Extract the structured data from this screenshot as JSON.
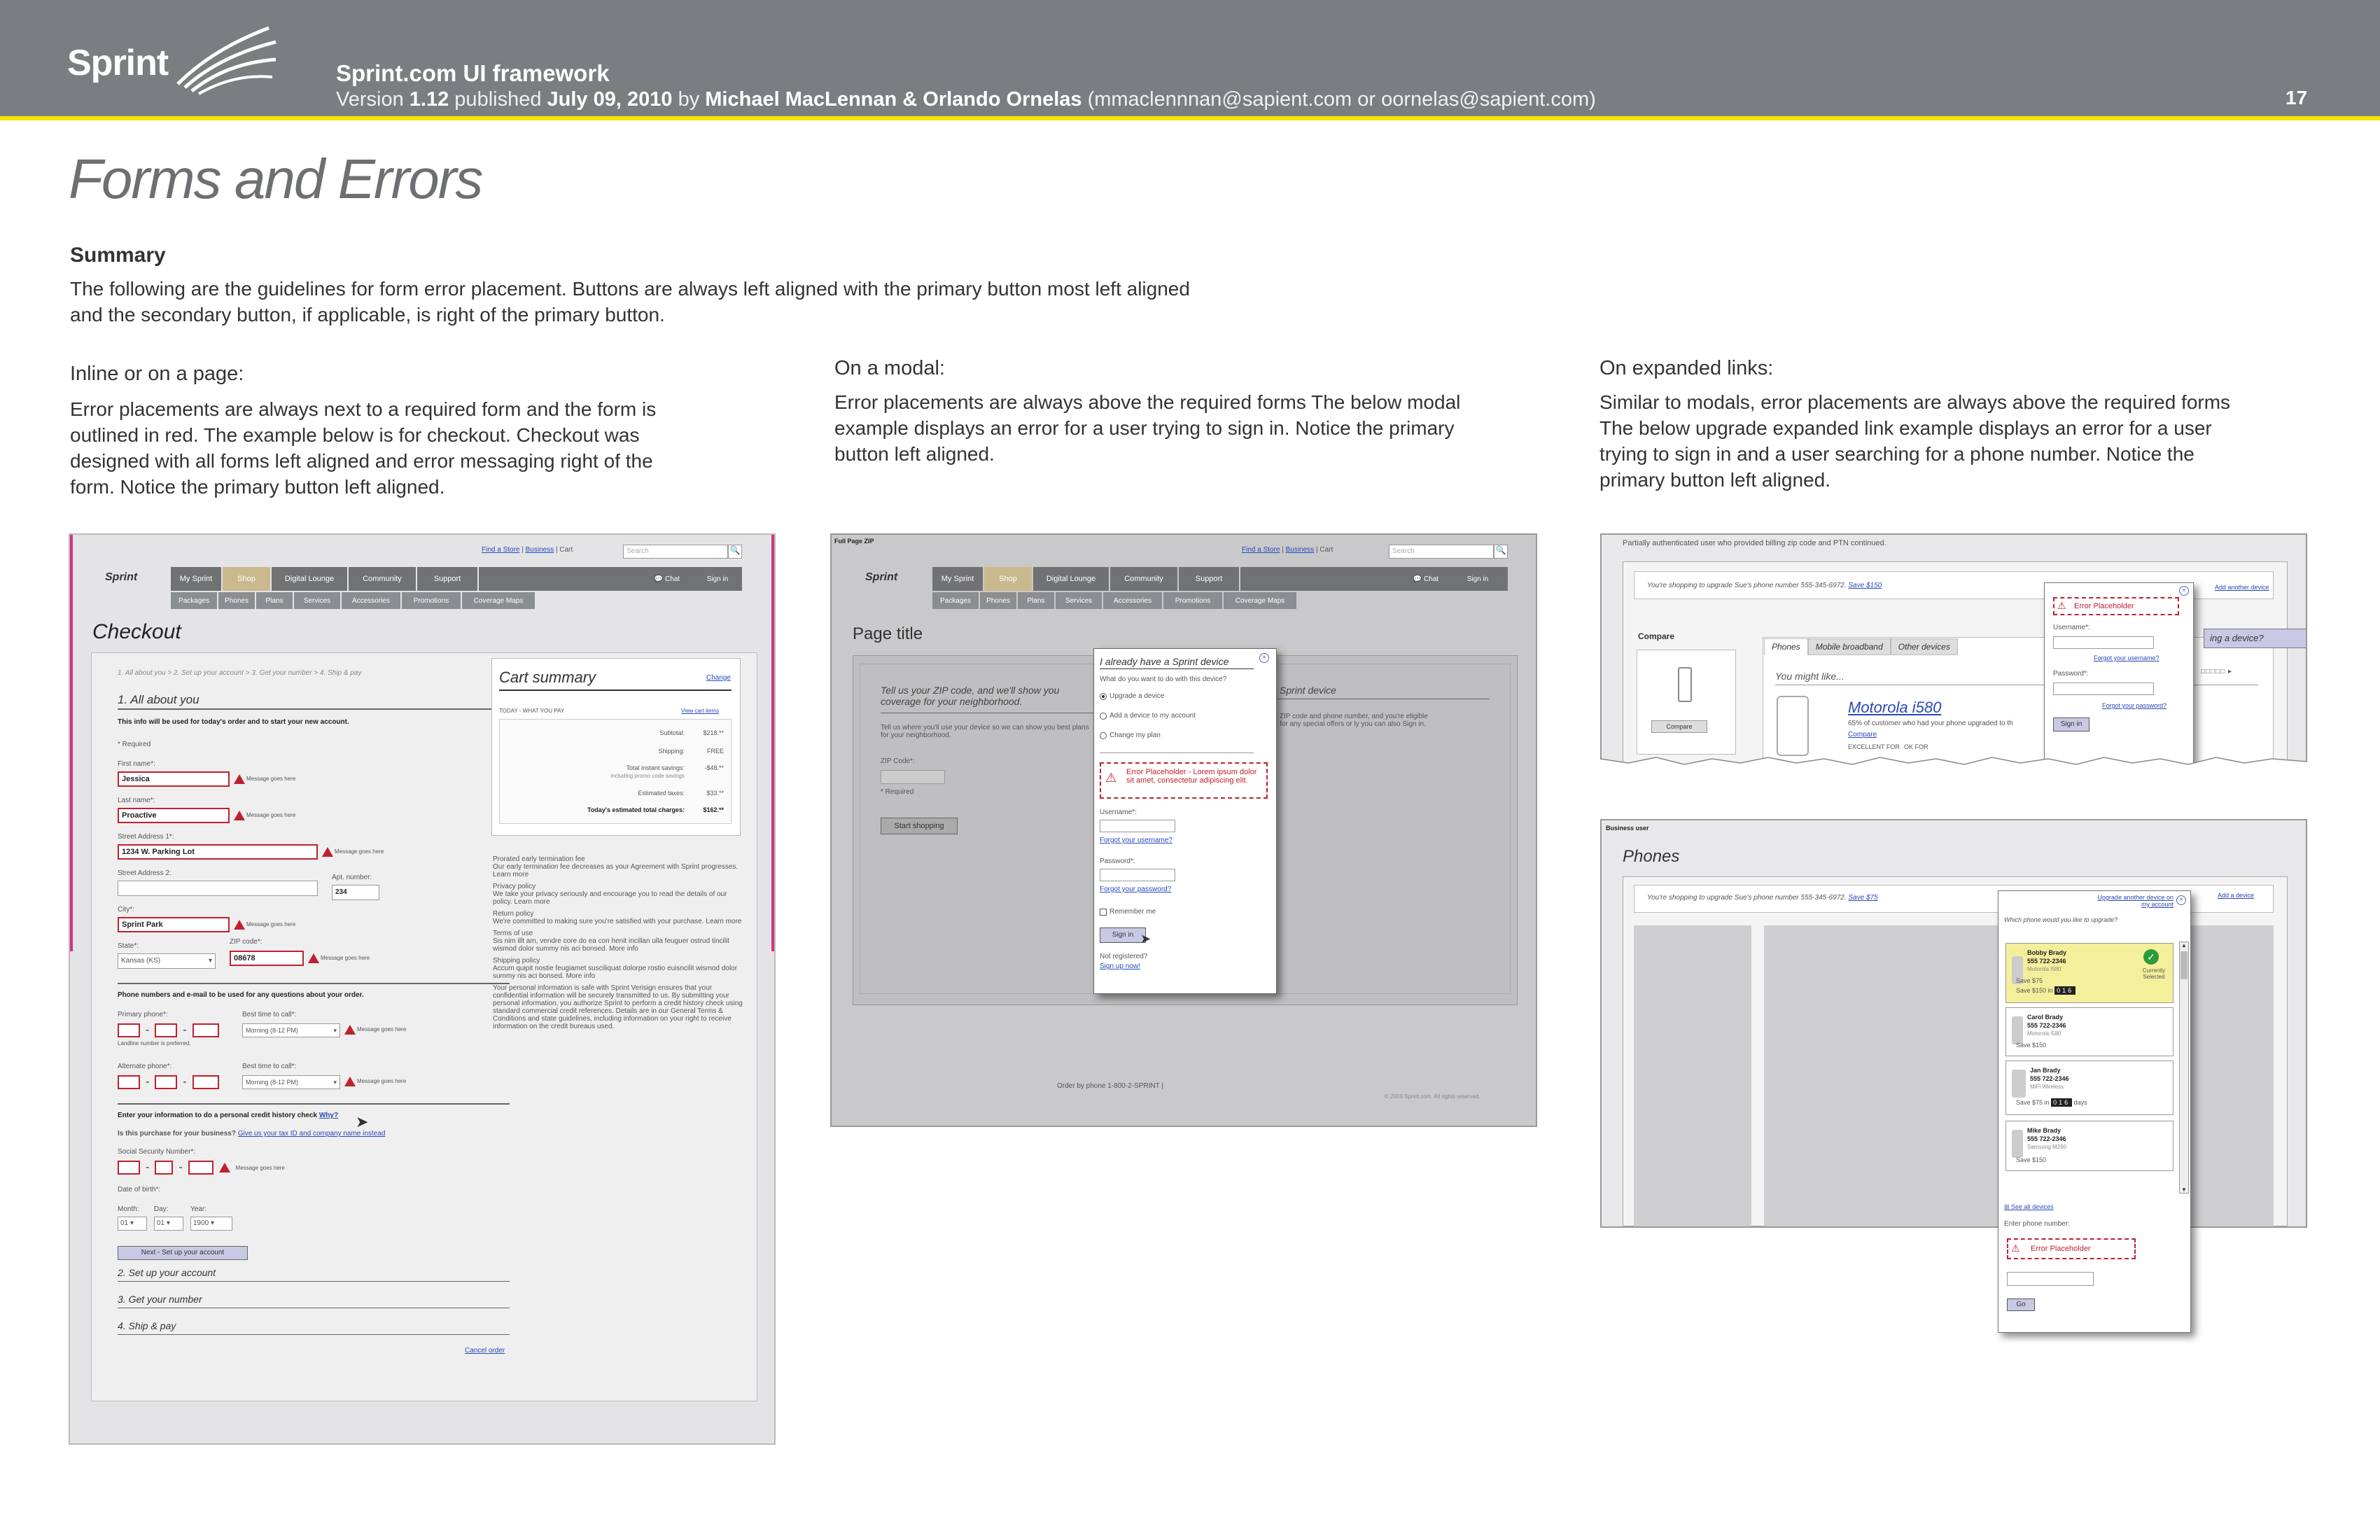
{
  "header": {
    "logo": "Sprint",
    "title": "Sprint.com UI framework",
    "version_prefix": "Version ",
    "version": "1.12",
    "published_label": " published ",
    "date": "July 09, 2010",
    "by_label": " by ",
    "authors": "Michael MacLennan & Orlando Ornelas",
    "emails": " (mmaclennnan@sapient.com or oornelas@sapient.com)",
    "page_number": "17"
  },
  "page_title": "Forms and Errors",
  "summary": {
    "heading": "Summary",
    "text": "The following are the guidelines for form error placement. Buttons are always left aligned with the primary button most left aligned and the secondary button, if applicable, is right of the primary button."
  },
  "columns": [
    {
      "heading": "Inline or on a page:",
      "text": "Error placements are always next to a required form and the form is outlined in red. The example below is for checkout. Checkout was designed with all forms left aligned and error messaging right of the form. Notice the primary button left aligned."
    },
    {
      "heading": "On a modal:",
      "text": "Error placements are always above the required forms The below modal example displays an error for a user trying to sign in. Notice the primary button left aligned."
    },
    {
      "heading": "On expanded links:",
      "text": "Similar to modals, error placements are always above the required forms The below upgrade expanded link example displays an error for a user trying to sign in and a user searching for a phone number. Notice the primary button left aligned."
    }
  ],
  "mock_common": {
    "find_store": "Find a Store",
    "business": "Business",
    "cart": "Cart",
    "search_placeholder": "Search",
    "logo": "Sprint",
    "nav1": [
      "My Sprint",
      "Shop",
      "Digital Lounge",
      "Community",
      "Support"
    ],
    "nav2": [
      "Packages",
      "Phones",
      "Plans",
      "Services",
      "Accessories",
      "Promotions",
      "Coverage Maps"
    ],
    "chat": "Chat",
    "sign_in": "Sign in"
  },
  "checkout": {
    "title": "Checkout",
    "steps": "1. All about you > 2. Set up your account > 3. Get your number > 4. Ship & pay",
    "section1": "1. All about you",
    "intro": "This info will be used for today's order and to start your new account.",
    "required": "* Required",
    "error_msg": "Message goes here",
    "first_name_label": "First name*:",
    "first_name": "Jessica",
    "last_name_label": "Last name*:",
    "last_name": "Proactive",
    "street1_label": "Street Address 1*:",
    "street1": "1234 W. Parking Lot",
    "street2_label": "Street Address 2:",
    "apt_label": "Apt. number:",
    "apt": "234",
    "city_label": "City*:",
    "city": "Sprint Park",
    "state_label": "State*:",
    "state": "Kansas (KS)",
    "zip_label": "ZIP code*:",
    "zip": "08678",
    "phone_heading": "Phone numbers and e-mail to be used for any questions about your order.",
    "primary_phone": "Primary phone*:",
    "best_time": "Best time to call*:",
    "best_time_value": "Morning (8-12 PM)",
    "landline_note": "Landline number is preferred.",
    "alt_phone": "Alternate phone*:",
    "credit_heading": "Enter your information to do a personal credit history check",
    "credit_why": "Why?",
    "business_q": "Is this purchase for your business?",
    "business_link": "Give us your tax ID and company name instead",
    "ssn_label": "Social Security Number*:",
    "dob_label": "Date of birth*:",
    "month": "Month:",
    "day": "Day:",
    "year": "Year:",
    "month_val": "01",
    "day_val": "01",
    "year_val": "1900",
    "next_button": "Next - Set up your account",
    "section2": "2. Set up your account",
    "section3": "3. Get your number",
    "section4": "4. Ship & pay",
    "cancel": "Cancel order",
    "cart_title": "Cart summary",
    "cart_change": "Change",
    "cart_today": "TODAY - WHAT YOU PAY",
    "cart_view": "View cart items",
    "cart_rows": [
      {
        "label": "Subtotal:",
        "value": "$218.**"
      },
      {
        "label": "Shipping:",
        "value": "FREE"
      },
      {
        "label": "Total instant savings:",
        "value": "-$48.**"
      },
      {
        "label": "including promo code savings",
        "value": ""
      },
      {
        "label": "Estimated taxes:",
        "value": "$33.**"
      }
    ],
    "cart_total_label": "Today's estimated total charges:",
    "cart_total": "$162.**",
    "policies": [
      {
        "title": "Prorated early termination fee",
        "text": "Our early termination fee decreases as your Agreement with Sprint progresses. Learn more"
      },
      {
        "title": "Privacy policy",
        "text": "We take your privacy seriously and encourage you to read the details of our policy. Learn more"
      },
      {
        "title": "Return policy",
        "text": "We're committed to making sure you're satisfied with your purchase. Learn more"
      },
      {
        "title": "Terms of use",
        "text": "Sis nim illt am, vendre core do ea con henit incillan ulla feuguer ostrud tincilit wismod dolor summy nis aci bonsed. More info"
      },
      {
        "title": "Shipping policy",
        "text": "Accum quipit nostie feugiamet susciliquat dolorpe rostio euisncilit wismod dolor summy nis aci bonsed. More info"
      },
      {
        "title": "",
        "text": "Your personal information is safe with Sprint Verisign ensures that your confidential information will be securely transmitted to us. By submitting your personal information, you authorize Sprint to perform a credit history check using standard commercial credit references. Details are in our General Terms & Conditions and state guidelines, including information on your right to receive information on the credit bureaus used."
      }
    ]
  },
  "modal_mock": {
    "label": "Full Page ZIP",
    "page_title": "Page title",
    "zip_intro": "Tell us your ZIP code, and we'll show you coverage for your neighborhood.",
    "zip_body": "Tell us where you'll use your device so we can show you best plans for your neighborhood.",
    "zip_label": "ZIP Code*:",
    "required": "* Required",
    "start_button": "Start shopping",
    "right_title": "Sprint device",
    "right_text": "ZIP code and phone number, and you're eligible for any special offers or ly you can also Sign in.",
    "modal_title": "I already have a Sprint device",
    "modal_q": "What do you want to do with this device?",
    "options": [
      "Upgrade a device",
      "Add a device to my account",
      "Change my plan"
    ],
    "error": "Error Placeholder - Lorem ipsum dolor sit amet, consectetur adipiscing elit.",
    "username": "Username*:",
    "forgot_user": "Forgot your username?",
    "password": "Password*:",
    "forgot_pass": "Forgot your password?",
    "remember": "Remember me",
    "sign_in": "Sign in",
    "not_registered": "Not registered?",
    "sign_up": "Sign up now!",
    "footer": "Order by phone 1-800-2-SPRINT |",
    "copyright": "© 2009 Sprint.com. All rights reserved."
  },
  "expanded1": {
    "caption": "Partially authenticated user who provided billing zip code and PTN continued.",
    "upgrade_text": "You're shopping to upgrade Sue's phone number 555-345-6972.",
    "save": "Save $150",
    "add_device": "Add another device",
    "compare_head": "Compare",
    "compare_btn": "Compare",
    "tabs": [
      "Phones",
      "Mobile broadband",
      "Other devices"
    ],
    "might_like": "You might like...",
    "phone": "Motorola i580",
    "phone_desc": "65% of customer who had your phone upgraded to th",
    "compare_link": "Compare",
    "excellent": "EXCELLENT FOR",
    "ok_for": "OK FOR",
    "finding": "ing a device?",
    "error": "Error Placeholder",
    "username": "Username*:",
    "forgot_user": "Forgot your username?",
    "password": "Password*:",
    "forgot_pass": "Forgot your password?",
    "sign_in": "Sign in"
  },
  "expanded2": {
    "label": "Business user",
    "title": "Phones",
    "upgrade_text": "You're shopping to upgrade Sue's phone number 555-345-6972.",
    "save": "Save $75",
    "upgrade_another": "Upgrade another device on my account",
    "add_device": "Add a device",
    "question": "Which phone would you like to upgrade?",
    "devices": [
      {
        "name": "Bobby Brady",
        "num": "555 722-2346",
        "model": "Motorola i580",
        "save": "Save $75",
        "save2": "Save $150 in",
        "days": "016",
        "selected": "Currently Selected"
      },
      {
        "name": "Carol Brady",
        "num": "555 722-2346",
        "model": "Motorola i580",
        "save": "Save $150"
      },
      {
        "name": "Jan Brady",
        "num": "555 722-2346",
        "model": "MiFi Wireless",
        "save": "Save $75 in",
        "days": "016",
        "days_label": "days"
      },
      {
        "name": "Mike Brady",
        "num": "555 722-2346",
        "model": "Samsung M260",
        "save": "Save $150"
      }
    ],
    "see_all": "See all devices",
    "enter_phone": "Enter phone number:",
    "error": "Error Placeholder",
    "go": "Go"
  },
  "colors": {
    "header_bg": "#7b7e81",
    "accent_yellow": "#f2e600",
    "error_red": "#c0202e",
    "magenta_frame": "#d1338a",
    "link": "#2a48b8"
  }
}
